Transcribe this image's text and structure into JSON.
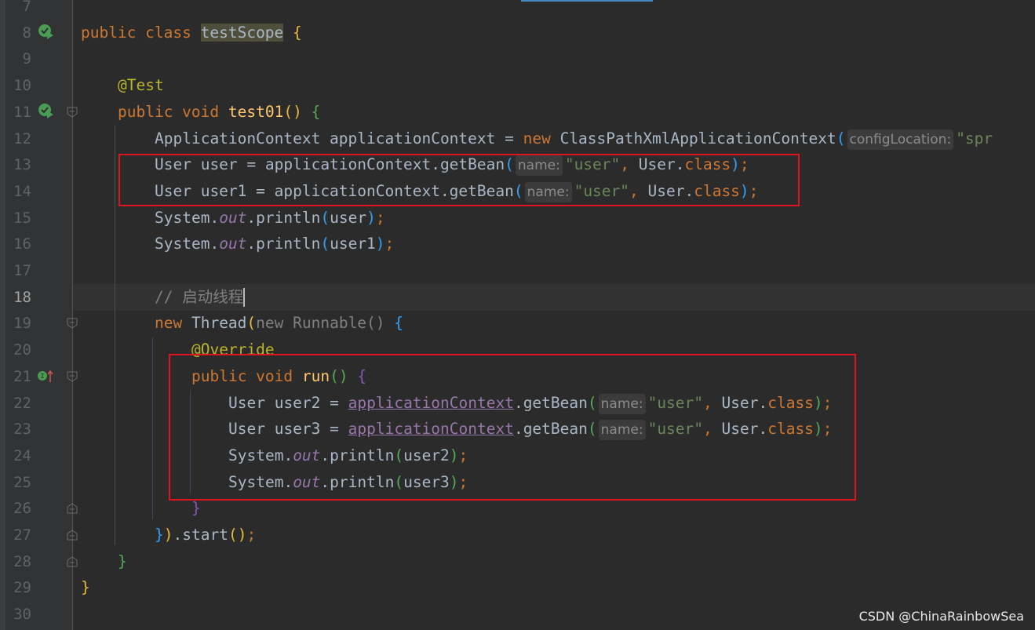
{
  "editor": {
    "current_line": 18,
    "lines": [
      {
        "n": 7,
        "indent": 0,
        "tokens": []
      },
      {
        "n": 8,
        "indent": 0,
        "icon": "run",
        "tokens": [
          {
            "t": "public class ",
            "c": "kw"
          },
          {
            "t": "testScope",
            "c": "cls-hl"
          },
          {
            "t": " "
          },
          {
            "t": "{",
            "c": "b1"
          }
        ]
      },
      {
        "n": 9,
        "indent": 0,
        "tokens": []
      },
      {
        "n": 10,
        "indent": 1,
        "tokens": [
          {
            "t": "@Test",
            "c": "ann"
          }
        ]
      },
      {
        "n": 11,
        "indent": 1,
        "icon": "run",
        "fold": true,
        "tokens": [
          {
            "t": "public void ",
            "c": "kw"
          },
          {
            "t": "test01",
            "c": "fn"
          },
          {
            "t": "()",
            "c": "b1"
          },
          {
            "t": " "
          },
          {
            "t": "{",
            "c": "b2"
          }
        ]
      },
      {
        "n": 12,
        "indent": 2,
        "tokens": [
          {
            "t": "ApplicationContext applicationContext = "
          },
          {
            "t": "new ",
            "c": "kw"
          },
          {
            "t": "ClassPathXmlApplicationContext"
          },
          {
            "t": "(",
            "c": "b3"
          },
          {
            "t": "configLocation:",
            "c": "hint"
          },
          {
            "t": "\"spr",
            "c": "str"
          }
        ]
      },
      {
        "n": 13,
        "indent": 2,
        "tokens": [
          {
            "t": "User user = applicationContext.getBean"
          },
          {
            "t": "(",
            "c": "b3"
          },
          {
            "t": "name:",
            "c": "hint"
          },
          {
            "t": "\"user\"",
            "c": "str"
          },
          {
            "t": ", ",
            "c": "kw"
          },
          {
            "t": "User."
          },
          {
            "t": "class",
            "c": "kw"
          },
          {
            "t": ")",
            "c": "b3"
          },
          {
            "t": ";",
            "c": "kw"
          }
        ]
      },
      {
        "n": 14,
        "indent": 2,
        "tokens": [
          {
            "t": "User user1 = applicationContext.getBean"
          },
          {
            "t": "(",
            "c": "b3"
          },
          {
            "t": "name:",
            "c": "hint"
          },
          {
            "t": "\"user\"",
            "c": "str"
          },
          {
            "t": ", ",
            "c": "kw"
          },
          {
            "t": "User."
          },
          {
            "t": "class",
            "c": "kw"
          },
          {
            "t": ")",
            "c": "b3"
          },
          {
            "t": ";",
            "c": "kw"
          }
        ]
      },
      {
        "n": 15,
        "indent": 2,
        "tokens": [
          {
            "t": "System."
          },
          {
            "t": "out",
            "c": "st"
          },
          {
            "t": ".println"
          },
          {
            "t": "(",
            "c": "b3"
          },
          {
            "t": "user"
          },
          {
            "t": ")",
            "c": "b3"
          },
          {
            "t": ";",
            "c": "kw"
          }
        ]
      },
      {
        "n": 16,
        "indent": 2,
        "tokens": [
          {
            "t": "System."
          },
          {
            "t": "out",
            "c": "st"
          },
          {
            "t": ".println"
          },
          {
            "t": "(",
            "c": "b3"
          },
          {
            "t": "user1"
          },
          {
            "t": ")",
            "c": "b3"
          },
          {
            "t": ";",
            "c": "kw"
          }
        ]
      },
      {
        "n": 17,
        "indent": 0,
        "tokens": []
      },
      {
        "n": 18,
        "indent": 2,
        "caret": true,
        "tokens": [
          {
            "t": "// 启动线程",
            "c": "cm"
          }
        ]
      },
      {
        "n": 19,
        "indent": 2,
        "fold": true,
        "tokens": [
          {
            "t": "new ",
            "c": "kw"
          },
          {
            "t": "Thread"
          },
          {
            "t": "(",
            "c": "b1"
          },
          {
            "t": "new Runnable() ",
            "c": "dim"
          },
          {
            "t": "{",
            "c": "b3"
          }
        ]
      },
      {
        "n": 20,
        "indent": 3,
        "tokens": [
          {
            "t": "@Override",
            "c": "ann"
          }
        ]
      },
      {
        "n": 21,
        "indent": 3,
        "icon": "implements",
        "fold": true,
        "tokens": [
          {
            "t": "public void ",
            "c": "kw"
          },
          {
            "t": "run",
            "c": "fn"
          },
          {
            "t": "()",
            "c": "b2"
          },
          {
            "t": " "
          },
          {
            "t": "{",
            "c": "b4"
          }
        ]
      },
      {
        "n": 22,
        "indent": 4,
        "tokens": [
          {
            "t": "User user2 = "
          },
          {
            "t": "applicationContext",
            "c": "fld"
          },
          {
            "t": ".getBean"
          },
          {
            "t": "(",
            "c": "b2"
          },
          {
            "t": "name:",
            "c": "hint"
          },
          {
            "t": "\"user\"",
            "c": "str"
          },
          {
            "t": ", ",
            "c": "kw"
          },
          {
            "t": "User."
          },
          {
            "t": "class",
            "c": "kw"
          },
          {
            "t": ")",
            "c": "b2"
          },
          {
            "t": ";",
            "c": "kw"
          }
        ]
      },
      {
        "n": 23,
        "indent": 4,
        "tokens": [
          {
            "t": "User user3 = "
          },
          {
            "t": "applicationContext",
            "c": "fld"
          },
          {
            "t": ".getBean"
          },
          {
            "t": "(",
            "c": "b2"
          },
          {
            "t": "name:",
            "c": "hint"
          },
          {
            "t": "\"user\"",
            "c": "str"
          },
          {
            "t": ", ",
            "c": "kw"
          },
          {
            "t": "User."
          },
          {
            "t": "class",
            "c": "kw"
          },
          {
            "t": ")",
            "c": "b2"
          },
          {
            "t": ";",
            "c": "kw"
          }
        ]
      },
      {
        "n": 24,
        "indent": 4,
        "tokens": [
          {
            "t": "System."
          },
          {
            "t": "out",
            "c": "st"
          },
          {
            "t": ".println"
          },
          {
            "t": "(",
            "c": "b2"
          },
          {
            "t": "user2"
          },
          {
            "t": ")",
            "c": "b2"
          },
          {
            "t": ";",
            "c": "kw"
          }
        ]
      },
      {
        "n": 25,
        "indent": 4,
        "tokens": [
          {
            "t": "System."
          },
          {
            "t": "out",
            "c": "st"
          },
          {
            "t": ".println"
          },
          {
            "t": "(",
            "c": "b2"
          },
          {
            "t": "user3"
          },
          {
            "t": ")",
            "c": "b2"
          },
          {
            "t": ";",
            "c": "kw"
          }
        ]
      },
      {
        "n": 26,
        "indent": 3,
        "foldend": true,
        "tokens": [
          {
            "t": "}",
            "c": "b4"
          }
        ]
      },
      {
        "n": 27,
        "indent": 2,
        "foldend": true,
        "tokens": [
          {
            "t": "}",
            "c": "b3"
          },
          {
            "t": ")",
            "c": "b1"
          },
          {
            "t": ".start"
          },
          {
            "t": "()",
            "c": "b1"
          },
          {
            "t": ";",
            "c": "kw"
          }
        ]
      },
      {
        "n": 28,
        "indent": 1,
        "foldend": true,
        "tokens": [
          {
            "t": "}",
            "c": "b2"
          }
        ]
      },
      {
        "n": 29,
        "indent": 0,
        "tokens": [
          {
            "t": "}",
            "c": "b1"
          }
        ]
      },
      {
        "n": 30,
        "indent": 0,
        "tokens": []
      }
    ]
  },
  "colors": {
    "highlight_box": "#e0141e",
    "keyword": "#cc7832",
    "string": "#6a8759",
    "annotation": "#bbb529"
  },
  "watermark": "CSDN @ChinaRainbowSea"
}
